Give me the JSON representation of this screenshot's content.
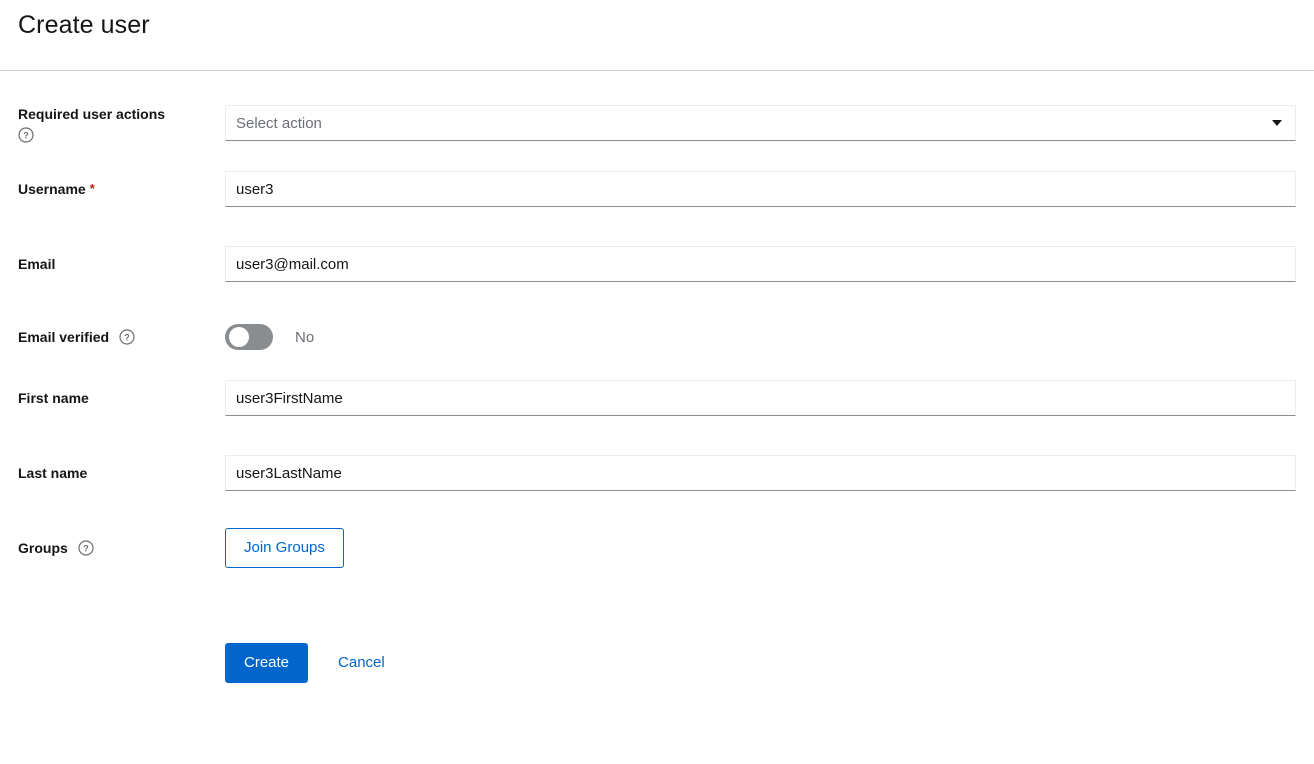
{
  "header": {
    "title": "Create user"
  },
  "colors": {
    "primary_blue": "#0066CC",
    "link_blue": "#0066CC",
    "required_red": "#C9190B",
    "switch_off": "#8A8D90",
    "border_light": "#EDEDED",
    "border_bottom": "#8A8D90",
    "divider": "#D2D2D2",
    "text": "#151515",
    "text_muted": "#6A6E73"
  },
  "form": {
    "required_user_actions": {
      "label": "Required user actions",
      "help_icon": "help-circle-icon",
      "placeholder": "Select action",
      "value": "",
      "caret_icon": "caret-down-icon"
    },
    "username": {
      "label": "Username",
      "required_marker": "*",
      "value": "user3",
      "placeholder": ""
    },
    "email": {
      "label": "Email",
      "value": "user3@mail.com",
      "placeholder": ""
    },
    "email_verified": {
      "label": "Email verified",
      "help_icon": "help-circle-icon",
      "state_label": "No",
      "checked": false
    },
    "first_name": {
      "label": "First name",
      "value": "user3FirstName",
      "placeholder": ""
    },
    "last_name": {
      "label": "Last name",
      "value": "user3LastName",
      "placeholder": ""
    },
    "groups": {
      "label": "Groups",
      "help_icon": "help-circle-icon",
      "join_button_label": "Join Groups"
    }
  },
  "actions": {
    "create_label": "Create",
    "cancel_label": "Cancel"
  }
}
